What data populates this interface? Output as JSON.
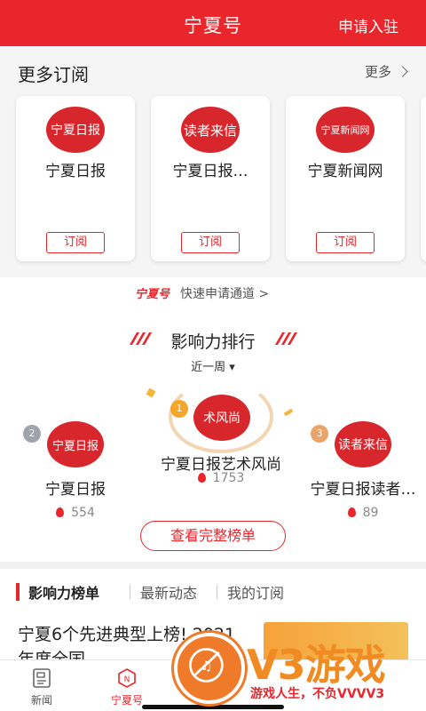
{
  "header": {
    "title": "宁夏号",
    "apply_label": "申请入驻"
  },
  "subscriptions": {
    "heading": "更多订阅",
    "more_label": "更多",
    "cards": [
      {
        "name": "宁夏日报",
        "logo_text": "宁夏日报",
        "button": "订阅"
      },
      {
        "name": "宁夏日报…",
        "logo_text": "读者来信",
        "button": "订阅"
      },
      {
        "name": "宁夏新闻网",
        "logo_text": "宁夏新闻网",
        "button": "订阅"
      }
    ]
  },
  "quick_apply": {
    "brand": "宁夏号",
    "label": "快速申请通道 >"
  },
  "ranking": {
    "title": "影响力排行",
    "period": "近一周 ▾",
    "items": [
      {
        "rank": "2",
        "name": "宁夏日报",
        "score": "554",
        "logo_text": "宁夏日报"
      },
      {
        "rank": "1",
        "name": "宁夏日报艺术风尚",
        "score": "1753",
        "logo_text": "术风尚"
      },
      {
        "rank": "3",
        "name": "宁夏日报读者…",
        "score": "89",
        "logo_text": "读者来信"
      }
    ],
    "full_list_label": "查看完整榜单"
  },
  "tabs": [
    {
      "label": "影响力榜单",
      "active": true
    },
    {
      "label": "最新动态",
      "active": false
    },
    {
      "label": "我的订阅",
      "active": false
    }
  ],
  "news": {
    "title": "宁夏6个先进典型上榜! 2021年度全国"
  },
  "bottom_nav": [
    {
      "label": "新闻",
      "icon": "newspaper-icon",
      "active": false
    },
    {
      "label": "宁夏号",
      "icon": "ningxia-badge-icon",
      "active": true
    }
  ],
  "watermark": {
    "logo": "V3游戏",
    "slogan": "游戏人生，不负VVVV3"
  },
  "colors": {
    "brand_red": "#e8262b",
    "watermark_orange": "#f08b23"
  }
}
